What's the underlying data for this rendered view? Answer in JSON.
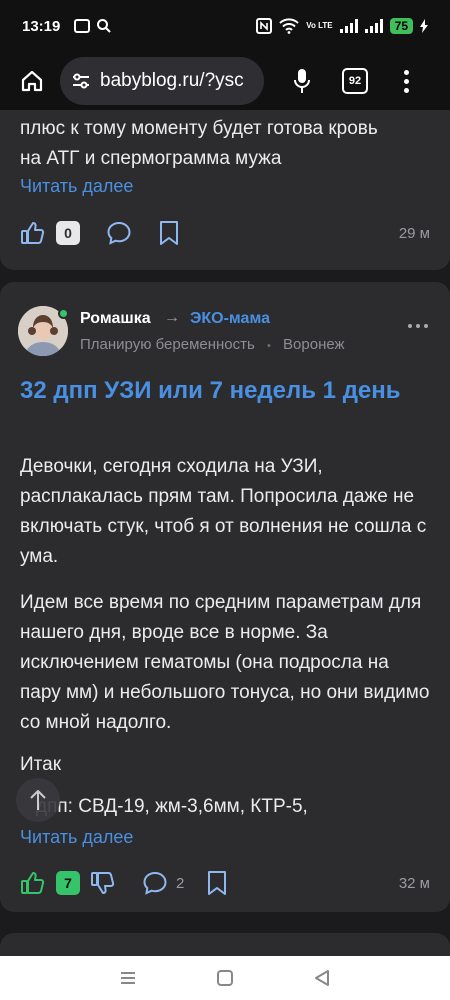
{
  "status_bar": {
    "time": "13:19",
    "battery": "75",
    "network": "Vo LTE"
  },
  "browser": {
    "url": "babyblog.ru/?ysc",
    "tab_count": "92"
  },
  "post_prev": {
    "text_lines": [
      "плюс к тому моменту будет готова кровь",
      "на АТГ и спермограмма мужа"
    ],
    "read_more": "Читать далее",
    "likes": "0",
    "time_ago": "29 м"
  },
  "post": {
    "author": "Ромашка",
    "arrow": "→",
    "community": "ЭКО-мама",
    "status": "Планирую беременность",
    "separator": "•",
    "city": "Воронеж",
    "title": "32 дпп УЗИ или 7 недель 1 день",
    "paragraph1": "Девочки, сегодня сходила на УЗИ, расплакалась прям там. Попросила даже не включать стук, чтоб я от волнения не сошла с ума.",
    "paragraph2": "Идем все время по средним параметрам для нашего дня, вроде все в норме. За исключением гематомы (она подросла на пару мм) и небольшого тонуса, но они видимо со мной надолго.",
    "paragraph3": "Итак",
    "paragraph4": "дпп: СВД-19, жм-3,6мм, КТР-5,",
    "read_more": "Читать далее",
    "likes": "7",
    "comments": "2",
    "time_ago": "32 м"
  }
}
